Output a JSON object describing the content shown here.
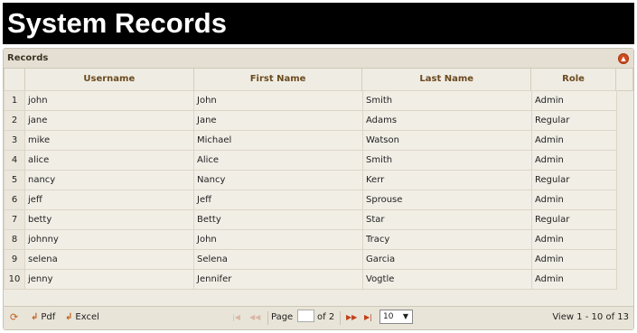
{
  "page": {
    "title": "System Records"
  },
  "grid": {
    "caption": "Records",
    "columns": [
      "Username",
      "First Name",
      "Last Name",
      "Role"
    ],
    "rows": [
      {
        "num": "1",
        "username": "john",
        "first_name": "John",
        "last_name": "Smith",
        "role": "Admin"
      },
      {
        "num": "2",
        "username": "jane",
        "first_name": "Jane",
        "last_name": "Adams",
        "role": "Regular"
      },
      {
        "num": "3",
        "username": "mike",
        "first_name": "Michael",
        "last_name": "Watson",
        "role": "Admin"
      },
      {
        "num": "4",
        "username": "alice",
        "first_name": "Alice",
        "last_name": "Smith",
        "role": "Admin"
      },
      {
        "num": "5",
        "username": "nancy",
        "first_name": "Nancy",
        "last_name": "Kerr",
        "role": "Regular"
      },
      {
        "num": "6",
        "username": "jeff",
        "first_name": "Jeff",
        "last_name": "Sprouse",
        "role": "Admin"
      },
      {
        "num": "7",
        "username": "betty",
        "first_name": "Betty",
        "last_name": "Star",
        "role": "Regular"
      },
      {
        "num": "8",
        "username": "johnny",
        "first_name": "John",
        "last_name": "Tracy",
        "role": "Admin"
      },
      {
        "num": "9",
        "username": "selena",
        "first_name": "Selena",
        "last_name": "Garcia",
        "role": "Admin"
      },
      {
        "num": "10",
        "username": "jenny",
        "first_name": "Jennifer",
        "last_name": "Vogtle",
        "role": "Admin"
      }
    ]
  },
  "pager": {
    "refresh_icon": "refresh-icon",
    "pdf_label": "Pdf",
    "excel_label": "Excel",
    "page_label": "Page",
    "page_value": "",
    "of_label": "of 2",
    "rows_per_page": "10",
    "view_info": "View 1 - 10 of 13"
  },
  "colors": {
    "banner_bg": "#000000",
    "accent": "#c0611b",
    "header_text": "#6b4a1f",
    "grid_bg": "#eeebe2"
  }
}
